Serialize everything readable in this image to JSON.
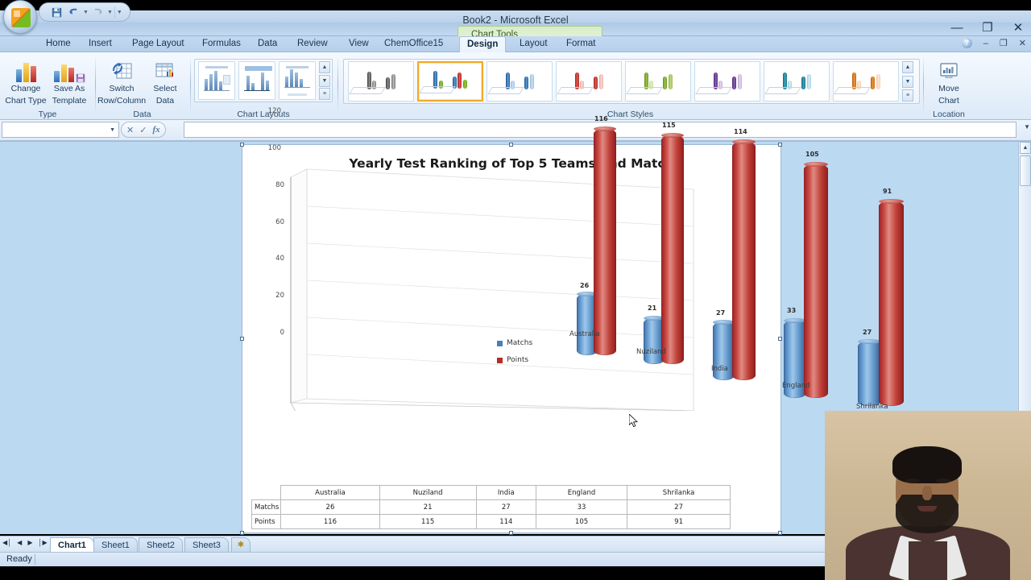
{
  "window": {
    "title": "Book2 - Microsoft Excel",
    "contextual_tab_title": "Chart Tools",
    "controls": {
      "minimize": "—",
      "maximize": "❐",
      "close": "✕"
    },
    "inner_controls": {
      "help": "?",
      "minimize": "–",
      "restore": "❐",
      "close": "✕"
    }
  },
  "quick_access": {
    "save": "💾",
    "undo": "↶",
    "redo": "↷",
    "customize": "≡"
  },
  "ribbon": {
    "tabs": [
      {
        "label": "Home",
        "active": false
      },
      {
        "label": "Insert",
        "active": false
      },
      {
        "label": "Page Layout",
        "active": false
      },
      {
        "label": "Formulas",
        "active": false
      },
      {
        "label": "Data",
        "active": false
      },
      {
        "label": "Review",
        "active": false
      },
      {
        "label": "View",
        "active": false
      },
      {
        "label": "ChemOffice15",
        "active": false
      },
      {
        "label": "Design",
        "active": true
      },
      {
        "label": "Layout",
        "active": false
      },
      {
        "label": "Format",
        "active": false
      }
    ],
    "groups": [
      {
        "label": "Type"
      },
      {
        "label": "Data"
      },
      {
        "label": "Chart Layouts"
      },
      {
        "label": "Chart Styles"
      },
      {
        "label": "Location"
      }
    ],
    "buttons": {
      "change_chart_type": "Change\nChart Type",
      "change_chart_type_l1": "Change",
      "change_chart_type_l2": "Chart Type",
      "save_as_template_l1": "Save As",
      "save_as_template_l2": "Template",
      "switch_row_column_l1": "Switch",
      "switch_row_column_l2": "Row/Column",
      "select_data_l1": "Select",
      "select_data_l2": "Data",
      "move_chart_l1": "Move",
      "move_chart_l2": "Chart"
    },
    "gallery_scroll": {
      "up": "▲",
      "down": "▼",
      "more": "≡"
    }
  },
  "formula_bar": {
    "name_box_value": "",
    "name_box_caret": "▼",
    "cancel": "✕",
    "enter": "✓",
    "fx": "fx",
    "formula_value": "",
    "expand": "▼"
  },
  "chart_data": {
    "type": "bar",
    "subtype": "3-D cylinder clustered column",
    "title": "Yearly  Test Ranking of Top 5 Teams and Match",
    "categories": [
      "Australia",
      "Nuziland",
      "India",
      "England",
      "Shrilanka"
    ],
    "series": [
      {
        "name": "Matchs",
        "color": "#4a7fb5",
        "values": [
          26,
          21,
          27,
          33,
          27
        ]
      },
      {
        "name": "Points",
        "color": "#c0392f",
        "values": [
          116,
          115,
          114,
          105,
          91
        ]
      }
    ],
    "ylim": [
      0,
      120
    ],
    "yticks": [
      0,
      20,
      40,
      60,
      80,
      100,
      120
    ],
    "ytick_labels": [
      "0",
      "20",
      "40",
      "60",
      "80",
      "100",
      "120"
    ],
    "xlabel": "",
    "ylabel": "",
    "grid": true,
    "legend_position": "right",
    "data_labels": true,
    "data_table": {
      "row_headers": [
        "Matchs",
        "Points"
      ],
      "column_headers": [
        "Australia",
        "Nuziland",
        "India",
        "England",
        "Shrilanka"
      ],
      "rows": [
        [
          "26",
          "21",
          "27",
          "33",
          "27"
        ],
        [
          "116",
          "115",
          "114",
          "105",
          "91"
        ]
      ]
    }
  },
  "sheet_tabs": {
    "nav": {
      "first": "◀│",
      "prev": "◀",
      "next": "▶",
      "last": "│▶"
    },
    "items": [
      {
        "label": "Chart1",
        "active": true
      },
      {
        "label": "Sheet1",
        "active": false
      },
      {
        "label": "Sheet2",
        "active": false
      },
      {
        "label": "Sheet3",
        "active": false
      }
    ],
    "new_sheet": "✱"
  },
  "status_bar": {
    "text": "Ready"
  }
}
